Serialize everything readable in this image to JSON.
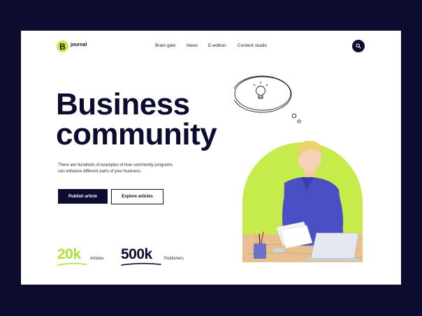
{
  "brand": {
    "badge": "B",
    "name": "journal"
  },
  "nav": [
    "Brain gain",
    "News",
    "E-edition",
    "Content studio"
  ],
  "hero": {
    "title_line1": "Business",
    "title_line2": "community",
    "description": "There are hundreds of examples of how community programs can enhance different parts of your business.",
    "primary_button": "Publish article",
    "secondary_button": "Explore articles"
  },
  "stats": [
    {
      "value": "20k",
      "label": "Articles",
      "color": "#a8e23a"
    },
    {
      "value": "500k",
      "label": "Publishers",
      "color": "#0b0c2e"
    }
  ],
  "colors": {
    "background": "#0b0c2e",
    "accent": "#c5ec4a",
    "card": "#ffffff"
  }
}
